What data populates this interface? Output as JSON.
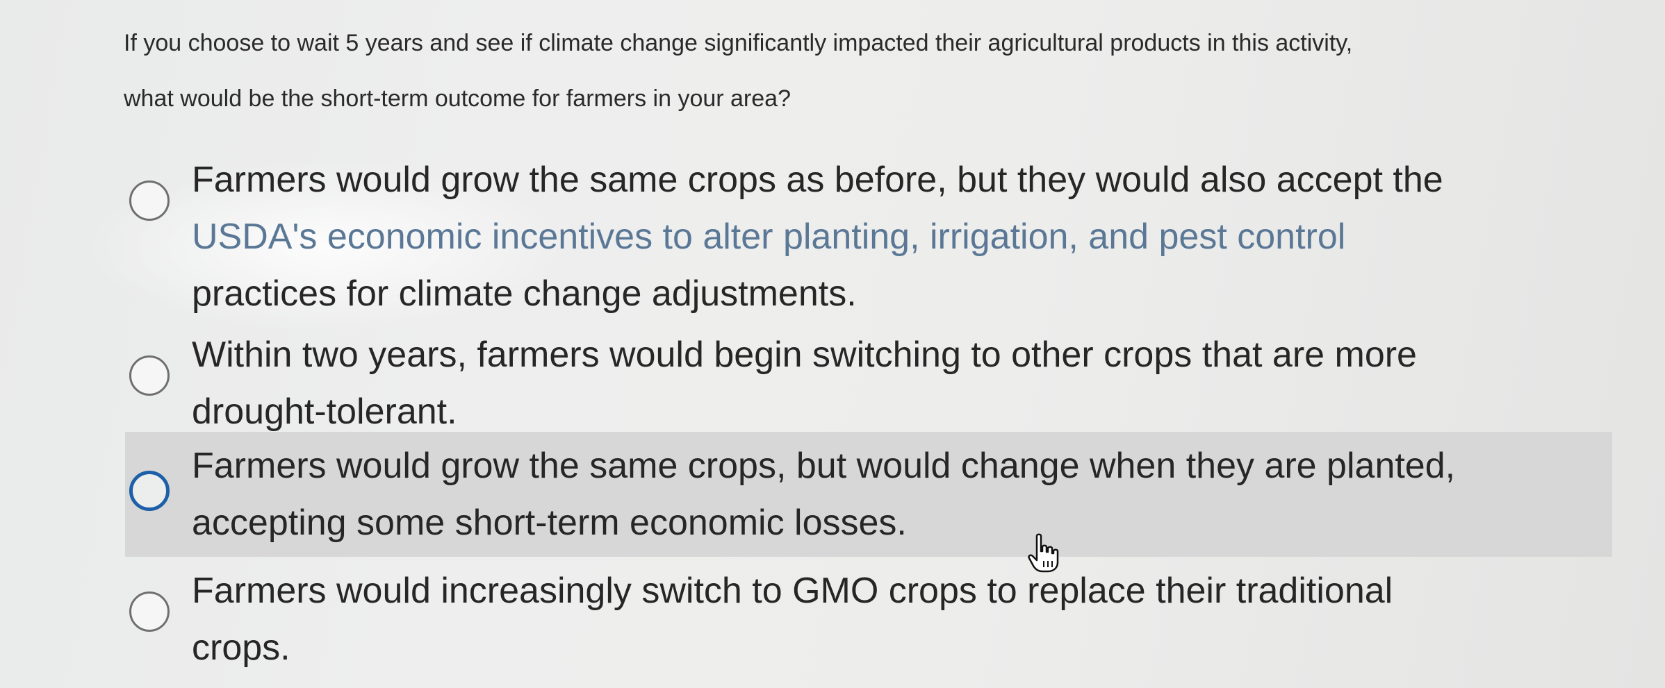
{
  "question": {
    "line1": "If you choose to wait 5 years and see if climate change significantly impacted their agricultural products in this activity,",
    "line2": "what would be the short-term outcome for farmers in your area?"
  },
  "options": [
    {
      "lines": [
        "Farmers would grow the same crops as before, but they would also accept the",
        "USDA's economic incentives to alter planting, irrigation, and pest control",
        "practices for climate change adjustments."
      ],
      "selected": false
    },
    {
      "lines": [
        "Within two years, farmers would begin switching to other crops that are more",
        "drought-tolerant."
      ],
      "selected": false
    },
    {
      "lines": [
        "Farmers would grow the same crops, but would change when they are planted,",
        "accepting some short-term economic losses."
      ],
      "selected": false,
      "hovered": true
    },
    {
      "lines": [
        "Farmers would increasingly switch to GMO crops to replace their traditional",
        "crops."
      ],
      "selected": false
    }
  ],
  "colors": {
    "hover_background": "#d6d7d6",
    "focus_ring": "#1d5fa8"
  },
  "cursor": {
    "icon": "hand-pointer-icon"
  }
}
